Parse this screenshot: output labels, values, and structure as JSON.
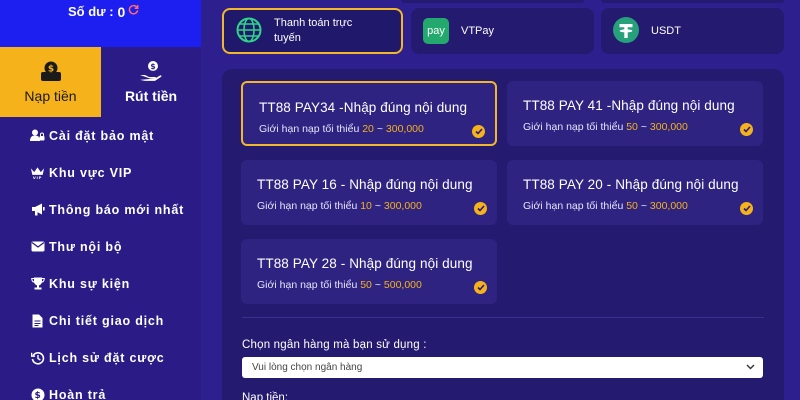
{
  "balance": {
    "label": "Số dư :",
    "amount": "0",
    "refresh_icon": "refresh-icon"
  },
  "sidebar_tabs": [
    {
      "label": "Nạp tiền",
      "icon": "deposit-icon",
      "active": true
    },
    {
      "label": "Rút tiền",
      "icon": "withdraw-icon",
      "active": false
    }
  ],
  "nav": [
    {
      "label": "Cài đặt bảo mật",
      "icon": "user-lock-icon"
    },
    {
      "label": "Khu vực VIP",
      "icon": "crown-vip-icon"
    },
    {
      "label": "Thông báo mới nhất",
      "icon": "megaphone-icon"
    },
    {
      "label": "Thư nội bộ",
      "icon": "envelope-icon"
    },
    {
      "label": "Khu sự kiện",
      "icon": "trophy-icon"
    },
    {
      "label": "Chi tiết giao dịch",
      "icon": "document-icon"
    },
    {
      "label": "Lịch sử đặt cược",
      "icon": "history-icon"
    },
    {
      "label": "Hoàn trả",
      "icon": "dollar-coin-icon"
    }
  ],
  "methods": [
    {
      "label": "Thanh toán trực tuyến",
      "icon": "globe-icon",
      "active": true
    },
    {
      "label": "VTPay",
      "icon": "viettel-pay-logo",
      "logo_text": "pay",
      "active": false
    },
    {
      "label": "USDT",
      "icon": "tether-logo",
      "active": false
    }
  ],
  "pay_cards": [
    {
      "title": "TT88 PAY34 -Nhập đúng nội dung",
      "limit_prefix": "Giới hạn nạp tối thiểu",
      "min": "20",
      "sep": "~",
      "max": "300,000",
      "selected": true
    },
    {
      "title": "TT88 PAY 41 -Nhập đúng nội dung",
      "limit_prefix": "Giới hạn nạp tối thiểu",
      "min": "50",
      "sep": "~",
      "max": "300,000",
      "selected": false
    },
    {
      "title": "TT88 PAY 16 - Nhập đúng nội dung",
      "limit_prefix": "Giới hạn nạp tối thiểu",
      "min": "10",
      "sep": "~",
      "max": "300,000",
      "selected": false
    },
    {
      "title": "TT88 PAY 20 - Nhập đúng nội dung",
      "limit_prefix": "Giới hạn nạp tối thiểu",
      "min": "50",
      "sep": "~",
      "max": "300,000",
      "selected": false
    },
    {
      "title": "TT88 PAY 28 - Nhập đúng nội dung",
      "limit_prefix": "Giới hạn nạp tối thiểu",
      "min": "50",
      "sep": "~",
      "max": "500,000",
      "selected": false
    }
  ],
  "bank": {
    "label": "Chọn ngân hàng mà bạn sử dụng :",
    "placeholder": "Vui lòng chọn ngân hàng"
  },
  "amount": {
    "label": "Nạp tiền:"
  },
  "colors": {
    "accent": "#f5b21b",
    "balance_bar": "#1d1ef0",
    "sidebar": "#2a1b86",
    "panel": "#241a6f",
    "card": "#2e2381",
    "vtpay": "#23a86e",
    "usdt": "#26a17b"
  }
}
